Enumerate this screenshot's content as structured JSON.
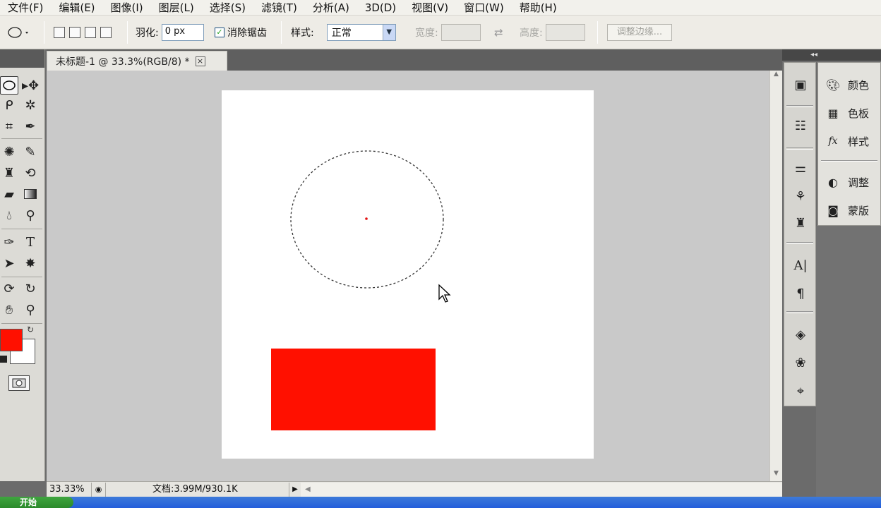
{
  "menu": {
    "items": [
      "文件(F)",
      "编辑(E)",
      "图像(I)",
      "图层(L)",
      "选择(S)",
      "滤镜(T)",
      "分析(A)",
      "3D(D)",
      "视图(V)",
      "窗口(W)",
      "帮助(H)"
    ]
  },
  "options": {
    "feather_label": "羽化:",
    "feather_value": "0 px",
    "antialias_label": "消除锯齿",
    "antialias_checked": true,
    "style_label": "样式:",
    "style_value": "正常",
    "width_label": "宽度:",
    "height_label": "高度:",
    "refine_label": "调整边缘..."
  },
  "tab": {
    "title": "未标题-1 @ 33.3%(RGB/8) *",
    "close": "×"
  },
  "status": {
    "zoom": "33.33%",
    "doc_info": "文档:3.99M/930.1K"
  },
  "colors": {
    "foreground": "#ff1000",
    "background": "#ffffff",
    "accent": "#ff1000"
  },
  "panels": {
    "header": "◂◂",
    "items": [
      {
        "label": "颜色",
        "icon": "palette-icon"
      },
      {
        "label": "色板",
        "icon": "swatches-icon"
      },
      {
        "label": "样式",
        "icon": "fx-style-icon"
      },
      {
        "label": "调整",
        "icon": "adjustment-icon"
      },
      {
        "label": "蒙版",
        "icon": "mask-icon"
      }
    ]
  },
  "taskbar": {
    "start_label": "开始"
  }
}
